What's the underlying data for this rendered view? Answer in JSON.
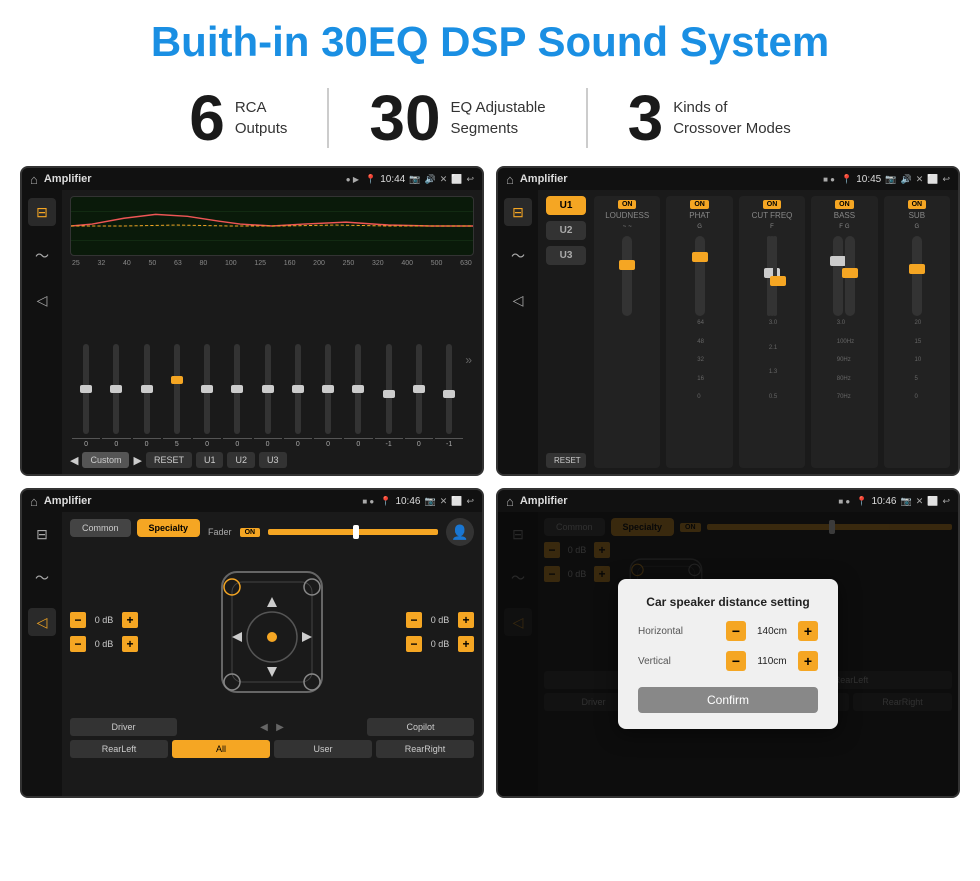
{
  "page": {
    "title": "Buith-in 30EQ DSP Sound System"
  },
  "stats": [
    {
      "number": "6",
      "text_line1": "RCA",
      "text_line2": "Outputs"
    },
    {
      "number": "30",
      "text_line1": "EQ Adjustable",
      "text_line2": "Segments"
    },
    {
      "number": "3",
      "text_line1": "Kinds of",
      "text_line2": "Crossover Modes"
    }
  ],
  "screen1": {
    "app_title": "Amplifier",
    "time": "10:44",
    "freq_labels": [
      "25",
      "32",
      "40",
      "50",
      "63",
      "80",
      "100",
      "125",
      "160",
      "200",
      "250",
      "320",
      "400",
      "500",
      "630"
    ],
    "slider_values": [
      "0",
      "0",
      "0",
      "5",
      "0",
      "0",
      "0",
      "0",
      "0",
      "0",
      "-1",
      "0",
      "-1"
    ],
    "buttons": [
      "Custom",
      "RESET",
      "U1",
      "U2",
      "U3"
    ]
  },
  "screen2": {
    "app_title": "Amplifier",
    "time": "10:45",
    "presets": [
      "U1",
      "U2",
      "U3"
    ],
    "controls": [
      {
        "label": "LOUDNESS",
        "on": true
      },
      {
        "label": "PHAT",
        "on": true
      },
      {
        "label": "CUT FREQ",
        "on": true
      },
      {
        "label": "BASS",
        "on": true
      },
      {
        "label": "SUB",
        "on": true
      }
    ],
    "reset_btn": "RESET"
  },
  "screen3": {
    "app_title": "Amplifier",
    "time": "10:46",
    "tabs": [
      "Common",
      "Specialty"
    ],
    "fader_label": "Fader",
    "fader_on": "ON",
    "db_values": [
      "0 dB",
      "0 dB",
      "0 dB",
      "0 dB"
    ],
    "bottom_buttons": [
      "Driver",
      "",
      "Copilot",
      "RearLeft",
      "All",
      "User",
      "RearRight"
    ]
  },
  "screen4": {
    "app_title": "Amplifier",
    "time": "10:46",
    "tabs": [
      "Common",
      "Specialty"
    ],
    "dialog": {
      "title": "Car speaker distance setting",
      "horizontal_label": "Horizontal",
      "horizontal_value": "140cm",
      "vertical_label": "Vertical",
      "vertical_value": "110cm",
      "confirm_label": "Confirm"
    },
    "db_values": [
      "0 dB",
      "0 dB"
    ],
    "bottom_buttons": [
      "Driver",
      "Copilot",
      "RearLeft",
      "User",
      "RearRight"
    ]
  },
  "icons": {
    "home": "⌂",
    "settings_sliders": "⊟",
    "waveform": "〜",
    "speaker": "◁",
    "arrow_left": "◀",
    "arrow_right": "▶",
    "expand": "»",
    "dots": "●",
    "play": "▶"
  }
}
